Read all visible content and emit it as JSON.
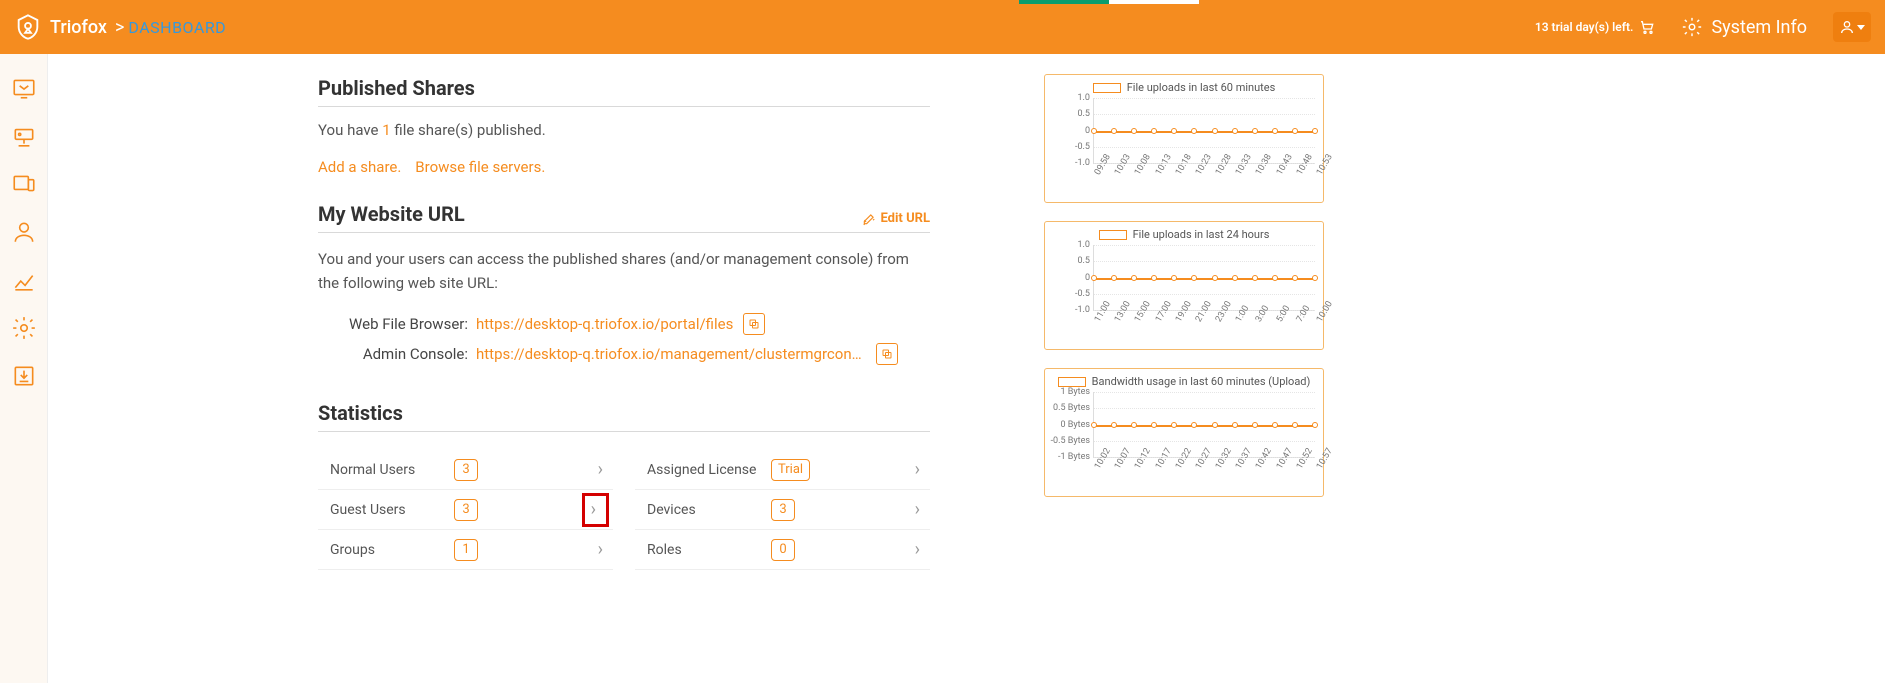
{
  "brand": {
    "name": "Triofox",
    "sep": ">",
    "crumb": "DASHBOARD"
  },
  "top": {
    "trial_text": "13 trial day(s) left.",
    "sysinfo": "System Info"
  },
  "rail": [
    {
      "name": "shares-icon"
    },
    {
      "name": "servers-icon"
    },
    {
      "name": "devices-icon"
    },
    {
      "name": "users-icon"
    },
    {
      "name": "reports-icon"
    },
    {
      "name": "settings-icon"
    },
    {
      "name": "download-icon"
    }
  ],
  "shares": {
    "title": "Published Shares",
    "pre": "You have ",
    "count": "1",
    "post": " file share(s) published.",
    "add": "Add a share.",
    "browse": "Browse file servers."
  },
  "url": {
    "title": "My Website URL",
    "edit": "Edit URL",
    "desc": "You and your users can access the published shares (and/or management console) from the following web site URL:",
    "rows": [
      {
        "label": "Web File Browser:",
        "value": "https://desktop-q.triofox.io/portal/files"
      },
      {
        "label": "Admin Console:",
        "value": "https://desktop-q.triofox.io/management/clustermgrconsole"
      }
    ]
  },
  "stats": {
    "title": "Statistics",
    "left": [
      {
        "label": "Normal Users",
        "value": "3",
        "hl": false
      },
      {
        "label": "Guest Users",
        "value": "3",
        "hl": true
      },
      {
        "label": "Groups",
        "value": "1",
        "hl": false
      }
    ],
    "right": [
      {
        "label": "Assigned License",
        "value": "Trial"
      },
      {
        "label": "Devices",
        "value": "3"
      },
      {
        "label": "Roles",
        "value": "0"
      }
    ]
  },
  "charts": [
    {
      "title": "File uploads in last 60 minutes",
      "yticks": [
        "1.0",
        "0.5",
        "0",
        "-0.5",
        "-1.0"
      ],
      "xticks": [
        "09:58",
        "10:03",
        "10:08",
        "10:13",
        "10:18",
        "10:23",
        "10:28",
        "10:33",
        "10:38",
        "10:43",
        "10:48",
        "10:53"
      ]
    },
    {
      "title": "File uploads in last 24 hours",
      "yticks": [
        "1.0",
        "0.5",
        "0",
        "-0.5",
        "-1.0"
      ],
      "xticks": [
        "11:00",
        "13:00",
        "15:00",
        "17:00",
        "19:00",
        "21:00",
        "23:00",
        "1:00",
        "3:00",
        "5:00",
        "7:00",
        "10:00"
      ]
    },
    {
      "title": "Bandwidth usage in last 60 minutes (Upload)",
      "yticks": [
        "1 Bytes",
        "0.5 Bytes",
        "0 Bytes",
        "-0.5 Bytes",
        "-1 Bytes"
      ],
      "xticks": [
        "10:02",
        "10:07",
        "10:12",
        "10:17",
        "10:22",
        "10:27",
        "10:32",
        "10:37",
        "10:42",
        "10:47",
        "10:52",
        "10:57"
      ]
    }
  ],
  "chart_data": [
    {
      "type": "line",
      "title": "File uploads in last 60 minutes",
      "x": [
        "09:58",
        "10:03",
        "10:08",
        "10:13",
        "10:18",
        "10:23",
        "10:28",
        "10:33",
        "10:38",
        "10:43",
        "10:48",
        "10:53"
      ],
      "values": [
        0,
        0,
        0,
        0,
        0,
        0,
        0,
        0,
        0,
        0,
        0,
        0
      ],
      "ylim": [
        -1,
        1
      ]
    },
    {
      "type": "line",
      "title": "File uploads in last 24 hours",
      "x": [
        "11:00",
        "13:00",
        "15:00",
        "17:00",
        "19:00",
        "21:00",
        "23:00",
        "1:00",
        "3:00",
        "5:00",
        "7:00",
        "10:00"
      ],
      "values": [
        0,
        0,
        0,
        0,
        0,
        0,
        0,
        0,
        0,
        0,
        0,
        0
      ],
      "ylim": [
        -1,
        1
      ]
    },
    {
      "type": "line",
      "title": "Bandwidth usage in last 60 minutes (Upload)",
      "x": [
        "10:02",
        "10:07",
        "10:12",
        "10:17",
        "10:22",
        "10:27",
        "10:32",
        "10:37",
        "10:42",
        "10:47",
        "10:52",
        "10:57"
      ],
      "values": [
        0,
        0,
        0,
        0,
        0,
        0,
        0,
        0,
        0,
        0,
        0,
        0
      ],
      "ylim": [
        -1,
        1
      ],
      "yunit": "Bytes"
    }
  ]
}
